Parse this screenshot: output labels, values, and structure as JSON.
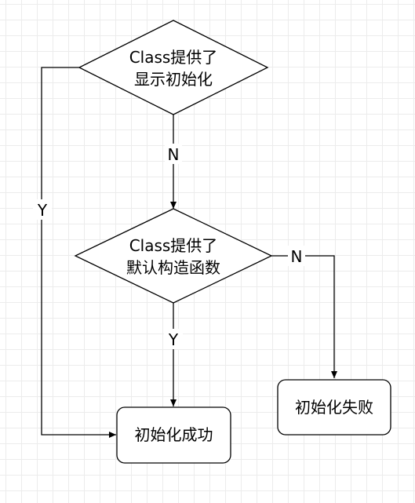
{
  "nodes": {
    "decision_init": {
      "shape": "diamond",
      "lines": [
        "Class提供了",
        "显示初始化"
      ]
    },
    "decision_ctor": {
      "shape": "diamond",
      "lines": [
        "Class提供了",
        "默认构造函数"
      ]
    },
    "init_success": {
      "shape": "rounded-rectangle",
      "text": "初始化成功"
    },
    "init_failure": {
      "shape": "rounded-rectangle",
      "text": "初始化失败"
    }
  },
  "edges": [
    {
      "from": "decision_init",
      "to": "decision_ctor",
      "label": "N"
    },
    {
      "from": "decision_init",
      "to": "init_success",
      "label": "Y"
    },
    {
      "from": "decision_ctor",
      "to": "init_success",
      "label": "Y"
    },
    {
      "from": "decision_ctor",
      "to": "init_failure",
      "label": "N"
    }
  ],
  "colors": {
    "stroke": "#000000",
    "fill": "#ffffff",
    "grid": "#ececec",
    "text": "#000000"
  }
}
